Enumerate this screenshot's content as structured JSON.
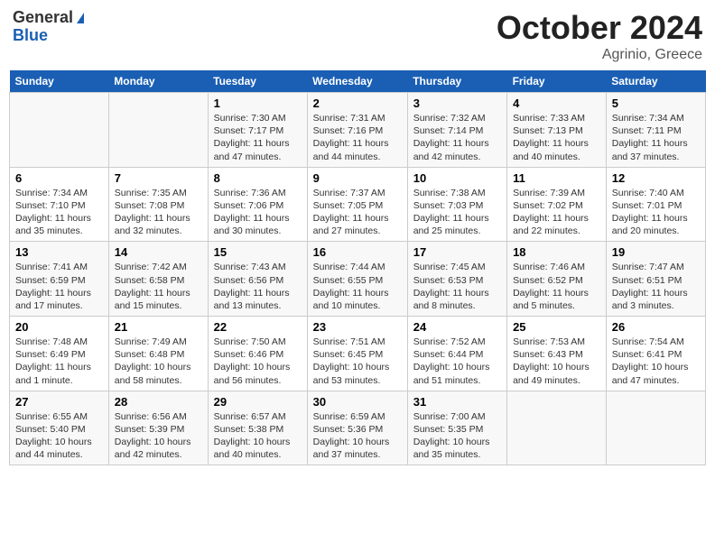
{
  "header": {
    "logo_general": "General",
    "logo_blue": "Blue",
    "month_title": "October 2024",
    "location": "Agrinio, Greece"
  },
  "weekdays": [
    "Sunday",
    "Monday",
    "Tuesday",
    "Wednesday",
    "Thursday",
    "Friday",
    "Saturday"
  ],
  "weeks": [
    [
      {
        "day": "",
        "sunrise": "",
        "sunset": "",
        "daylight": ""
      },
      {
        "day": "",
        "sunrise": "",
        "sunset": "",
        "daylight": ""
      },
      {
        "day": "1",
        "sunrise": "Sunrise: 7:30 AM",
        "sunset": "Sunset: 7:17 PM",
        "daylight": "Daylight: 11 hours and 47 minutes."
      },
      {
        "day": "2",
        "sunrise": "Sunrise: 7:31 AM",
        "sunset": "Sunset: 7:16 PM",
        "daylight": "Daylight: 11 hours and 44 minutes."
      },
      {
        "day": "3",
        "sunrise": "Sunrise: 7:32 AM",
        "sunset": "Sunset: 7:14 PM",
        "daylight": "Daylight: 11 hours and 42 minutes."
      },
      {
        "day": "4",
        "sunrise": "Sunrise: 7:33 AM",
        "sunset": "Sunset: 7:13 PM",
        "daylight": "Daylight: 11 hours and 40 minutes."
      },
      {
        "day": "5",
        "sunrise": "Sunrise: 7:34 AM",
        "sunset": "Sunset: 7:11 PM",
        "daylight": "Daylight: 11 hours and 37 minutes."
      }
    ],
    [
      {
        "day": "6",
        "sunrise": "Sunrise: 7:34 AM",
        "sunset": "Sunset: 7:10 PM",
        "daylight": "Daylight: 11 hours and 35 minutes."
      },
      {
        "day": "7",
        "sunrise": "Sunrise: 7:35 AM",
        "sunset": "Sunset: 7:08 PM",
        "daylight": "Daylight: 11 hours and 32 minutes."
      },
      {
        "day": "8",
        "sunrise": "Sunrise: 7:36 AM",
        "sunset": "Sunset: 7:06 PM",
        "daylight": "Daylight: 11 hours and 30 minutes."
      },
      {
        "day": "9",
        "sunrise": "Sunrise: 7:37 AM",
        "sunset": "Sunset: 7:05 PM",
        "daylight": "Daylight: 11 hours and 27 minutes."
      },
      {
        "day": "10",
        "sunrise": "Sunrise: 7:38 AM",
        "sunset": "Sunset: 7:03 PM",
        "daylight": "Daylight: 11 hours and 25 minutes."
      },
      {
        "day": "11",
        "sunrise": "Sunrise: 7:39 AM",
        "sunset": "Sunset: 7:02 PM",
        "daylight": "Daylight: 11 hours and 22 minutes."
      },
      {
        "day": "12",
        "sunrise": "Sunrise: 7:40 AM",
        "sunset": "Sunset: 7:01 PM",
        "daylight": "Daylight: 11 hours and 20 minutes."
      }
    ],
    [
      {
        "day": "13",
        "sunrise": "Sunrise: 7:41 AM",
        "sunset": "Sunset: 6:59 PM",
        "daylight": "Daylight: 11 hours and 17 minutes."
      },
      {
        "day": "14",
        "sunrise": "Sunrise: 7:42 AM",
        "sunset": "Sunset: 6:58 PM",
        "daylight": "Daylight: 11 hours and 15 minutes."
      },
      {
        "day": "15",
        "sunrise": "Sunrise: 7:43 AM",
        "sunset": "Sunset: 6:56 PM",
        "daylight": "Daylight: 11 hours and 13 minutes."
      },
      {
        "day": "16",
        "sunrise": "Sunrise: 7:44 AM",
        "sunset": "Sunset: 6:55 PM",
        "daylight": "Daylight: 11 hours and 10 minutes."
      },
      {
        "day": "17",
        "sunrise": "Sunrise: 7:45 AM",
        "sunset": "Sunset: 6:53 PM",
        "daylight": "Daylight: 11 hours and 8 minutes."
      },
      {
        "day": "18",
        "sunrise": "Sunrise: 7:46 AM",
        "sunset": "Sunset: 6:52 PM",
        "daylight": "Daylight: 11 hours and 5 minutes."
      },
      {
        "day": "19",
        "sunrise": "Sunrise: 7:47 AM",
        "sunset": "Sunset: 6:51 PM",
        "daylight": "Daylight: 11 hours and 3 minutes."
      }
    ],
    [
      {
        "day": "20",
        "sunrise": "Sunrise: 7:48 AM",
        "sunset": "Sunset: 6:49 PM",
        "daylight": "Daylight: 11 hours and 1 minute."
      },
      {
        "day": "21",
        "sunrise": "Sunrise: 7:49 AM",
        "sunset": "Sunset: 6:48 PM",
        "daylight": "Daylight: 10 hours and 58 minutes."
      },
      {
        "day": "22",
        "sunrise": "Sunrise: 7:50 AM",
        "sunset": "Sunset: 6:46 PM",
        "daylight": "Daylight: 10 hours and 56 minutes."
      },
      {
        "day": "23",
        "sunrise": "Sunrise: 7:51 AM",
        "sunset": "Sunset: 6:45 PM",
        "daylight": "Daylight: 10 hours and 53 minutes."
      },
      {
        "day": "24",
        "sunrise": "Sunrise: 7:52 AM",
        "sunset": "Sunset: 6:44 PM",
        "daylight": "Daylight: 10 hours and 51 minutes."
      },
      {
        "day": "25",
        "sunrise": "Sunrise: 7:53 AM",
        "sunset": "Sunset: 6:43 PM",
        "daylight": "Daylight: 10 hours and 49 minutes."
      },
      {
        "day": "26",
        "sunrise": "Sunrise: 7:54 AM",
        "sunset": "Sunset: 6:41 PM",
        "daylight": "Daylight: 10 hours and 47 minutes."
      }
    ],
    [
      {
        "day": "27",
        "sunrise": "Sunrise: 6:55 AM",
        "sunset": "Sunset: 5:40 PM",
        "daylight": "Daylight: 10 hours and 44 minutes."
      },
      {
        "day": "28",
        "sunrise": "Sunrise: 6:56 AM",
        "sunset": "Sunset: 5:39 PM",
        "daylight": "Daylight: 10 hours and 42 minutes."
      },
      {
        "day": "29",
        "sunrise": "Sunrise: 6:57 AM",
        "sunset": "Sunset: 5:38 PM",
        "daylight": "Daylight: 10 hours and 40 minutes."
      },
      {
        "day": "30",
        "sunrise": "Sunrise: 6:59 AM",
        "sunset": "Sunset: 5:36 PM",
        "daylight": "Daylight: 10 hours and 37 minutes."
      },
      {
        "day": "31",
        "sunrise": "Sunrise: 7:00 AM",
        "sunset": "Sunset: 5:35 PM",
        "daylight": "Daylight: 10 hours and 35 minutes."
      },
      {
        "day": "",
        "sunrise": "",
        "sunset": "",
        "daylight": ""
      },
      {
        "day": "",
        "sunrise": "",
        "sunset": "",
        "daylight": ""
      }
    ]
  ]
}
